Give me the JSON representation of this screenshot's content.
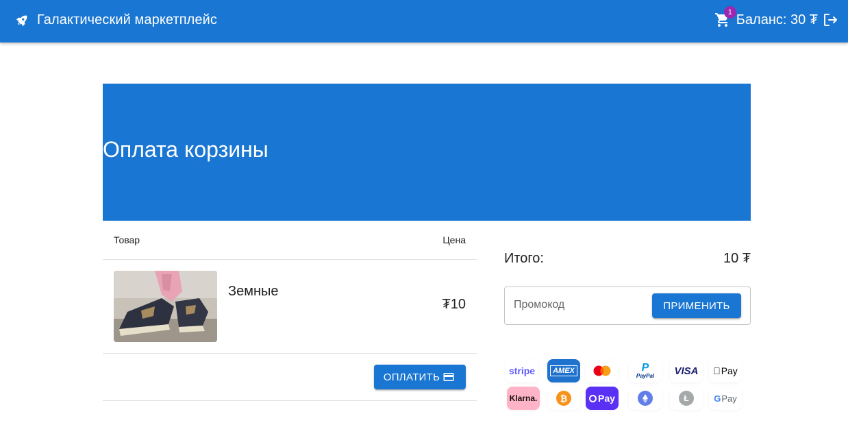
{
  "header": {
    "brand_title": "Галактический маркетплейс",
    "cart_count": "1",
    "balance": "Баланс: 30 ₮",
    "brand_color": "#1976d2",
    "badge_color": "#9c27b0"
  },
  "hero": {
    "title": "Оплата корзины"
  },
  "table": {
    "col_item": "Товар",
    "col_price": "Цена",
    "rows": [
      {
        "name": "Земные",
        "price": "₮10"
      }
    ],
    "pay_label": "ОПЛАТИТЬ"
  },
  "summary": {
    "total_label": "Итого:",
    "total_value": "10 ₮",
    "promo_placeholder": "Промокод",
    "apply_label": "ПРИМЕНИТЬ"
  },
  "payment_methods": [
    {
      "name": "stripe-logo",
      "text": "stripe"
    },
    {
      "name": "amex-logo",
      "text": "AMEX"
    },
    {
      "name": "mastercard-logo",
      "text": ""
    },
    {
      "name": "paypal-logo",
      "text": "PayPal"
    },
    {
      "name": "visa-logo",
      "text": "VISA"
    },
    {
      "name": "apple-pay-logo",
      "text": "Pay"
    },
    {
      "name": "klarna-logo",
      "text": "Klarna."
    },
    {
      "name": "bitcoin-logo",
      "text": "₿"
    },
    {
      "name": "opay-logo",
      "text": "Pay"
    },
    {
      "name": "ethereum-logo",
      "text": ""
    },
    {
      "name": "litecoin-logo",
      "text": "Ł"
    },
    {
      "name": "google-pay-logo",
      "text": "Pay"
    }
  ]
}
